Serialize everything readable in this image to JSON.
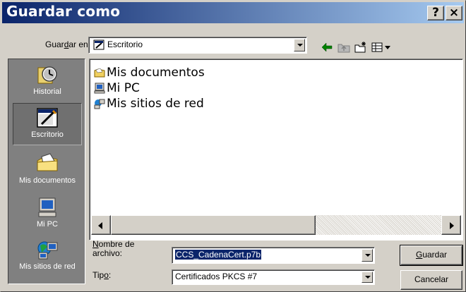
{
  "window": {
    "title": "Guardar como",
    "help_label": "?",
    "close_label": "×"
  },
  "location": {
    "label_pre": "Guar",
    "label_accel": "d",
    "label_post": "ar en:",
    "value": "Escritorio"
  },
  "places": [
    {
      "label": "Historial",
      "icon": "history-icon"
    },
    {
      "label": "Escritorio",
      "icon": "desktop-icon",
      "selected": true
    },
    {
      "label": "Mis documentos",
      "icon": "my-documents-icon"
    },
    {
      "label": "Mi PC",
      "icon": "my-computer-icon"
    },
    {
      "label": "Mis sitios de red",
      "icon": "network-places-icon"
    }
  ],
  "files": [
    {
      "name": "Mis documentos",
      "icon": "folder-documents-icon"
    },
    {
      "name": "Mi PC",
      "icon": "computer-icon"
    },
    {
      "name": "Mis sitios de red",
      "icon": "network-icon"
    }
  ],
  "filename": {
    "label_accel": "N",
    "label_line1_rest": "ombre de",
    "label_line2": "archivo:",
    "value": "CCS_CadenaCert.p7b"
  },
  "filetype": {
    "label_pre": "Tip",
    "label_accel": "o",
    "label_post": ":",
    "value": "Certificados PKCS #7"
  },
  "buttons": {
    "save_accel": "G",
    "save_rest": "uardar",
    "cancel": "Cancelar"
  },
  "colors": {
    "titlebar": "#0a246a",
    "face": "#d4d0c8",
    "places_bg": "#808080",
    "selection": "#0a246a"
  }
}
